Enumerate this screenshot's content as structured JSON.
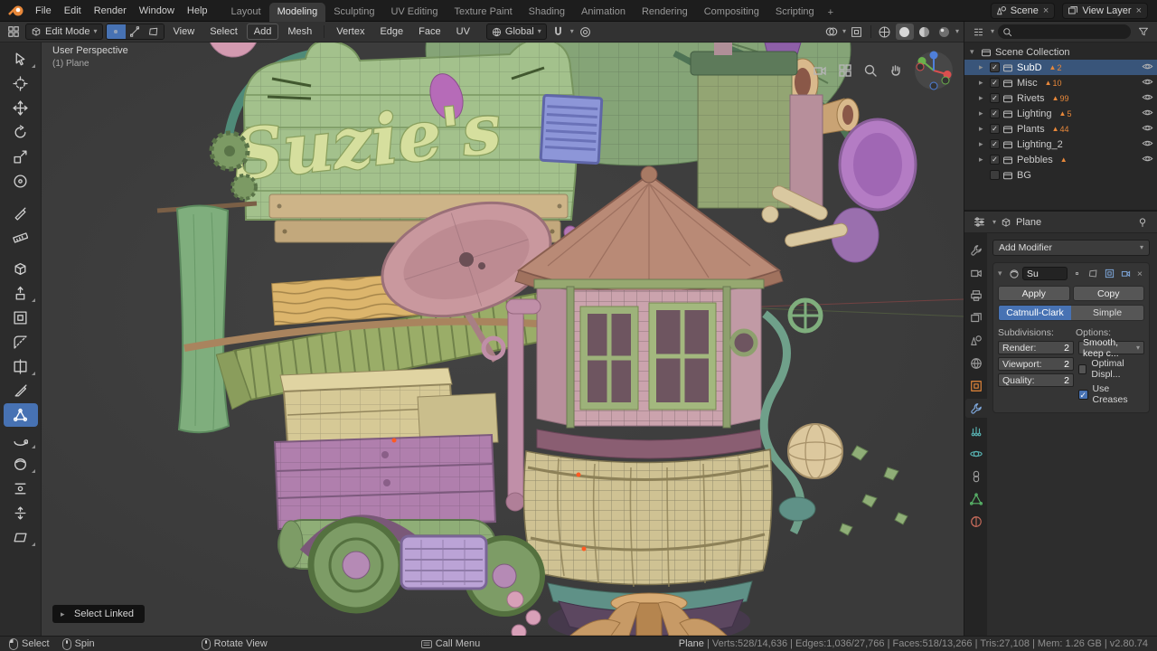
{
  "icons": {
    "chevron_down": "▾",
    "triangle_down": "▾",
    "triangle_right": "▸",
    "check": "✓",
    "close": "×",
    "plus": "+",
    "mesh_badge": "▲"
  },
  "topbar": {
    "app_menus": [
      "File",
      "Edit",
      "Render",
      "Window",
      "Help"
    ],
    "workspaces": [
      "Layout",
      "Modeling",
      "Sculpting",
      "UV Editing",
      "Texture Paint",
      "Shading",
      "Animation",
      "Rendering",
      "Compositing",
      "Scripting"
    ],
    "active_workspace": "Modeling",
    "scene_selector": {
      "label": "Scene"
    },
    "view_layer_selector": {
      "label": "View Layer"
    }
  },
  "viewport_header": {
    "mode_selector": "Edit Mode",
    "menus": [
      "View",
      "Select",
      "Add",
      "Mesh"
    ],
    "active_menu": "Add",
    "mesh_menus": [
      "Vertex",
      "Edge",
      "Face",
      "UV"
    ],
    "orientation": "Global"
  },
  "tool_strip": {
    "tools": [
      "select-box",
      "cursor",
      "move",
      "rotate",
      "scale",
      "transform",
      "annotate",
      "measure",
      "add-cube",
      "extrude-region",
      "inset-faces",
      "bevel",
      "loop-cut",
      "knife",
      "poly-build",
      "spin",
      "smooth",
      "edge-slide",
      "shrink-fatten",
      "shear"
    ],
    "active_tool": "poly-build"
  },
  "viewport": {
    "perspective_label": "User Perspective",
    "object_label": "(1) Plane",
    "keymap_hint": "Select Linked",
    "sign_text": "Suzie's"
  },
  "outliner": {
    "root": "Scene Collection",
    "items": [
      {
        "label": "SubD",
        "badges": [
          "2"
        ],
        "checked": true,
        "selected": true
      },
      {
        "label": "Misc",
        "badges": [
          "10"
        ],
        "checked": true
      },
      {
        "label": "Rivets",
        "badges": [
          "99"
        ],
        "checked": true
      },
      {
        "label": "Lighting",
        "badges": [
          "5"
        ],
        "checked": true
      },
      {
        "label": "Plants",
        "badges": [
          "44"
        ],
        "checked": true
      },
      {
        "label": "Lighting_2",
        "badges": [],
        "checked": true
      },
      {
        "label": "Pebbles",
        "badges": [],
        "checked": true
      },
      {
        "label": "BG",
        "badges": [],
        "checked": false
      }
    ]
  },
  "properties": {
    "breadcrumb_object": "Plane",
    "add_modifier_label": "Add Modifier",
    "modifier": {
      "name": "Su",
      "apply_label": "Apply",
      "copy_label": "Copy",
      "algorithm_options": [
        "Catmull-Clark",
        "Simple"
      ],
      "active_algorithm": "Catmull-Clark",
      "subdivisions_label": "Subdivisions:",
      "options_label": "Options:",
      "fields": [
        {
          "label": "Render:",
          "value": "2"
        },
        {
          "label": "Viewport:",
          "value": "2"
        },
        {
          "label": "Quality:",
          "value": "2"
        }
      ],
      "uv_smooth_value": "Smooth, keep c...",
      "optimal_display_label": "Optimal Displ...",
      "optimal_display_checked": false,
      "use_creases_label": "Use Creases",
      "use_creases_checked": true
    }
  },
  "status_bar": {
    "hints": [
      "Select",
      "Spin",
      "Rotate View",
      "Call Menu"
    ],
    "stats": {
      "object": "Plane",
      "rest": " | Verts:528/14,636 | Edges:1,036/27,766 | Faces:518/13,266 | Tris:27,108 | Mem: 1.26 GB | v2.80.74"
    }
  },
  "colors": {
    "accent_blue": "#4772b3",
    "badge_orange": "#e8883a"
  }
}
